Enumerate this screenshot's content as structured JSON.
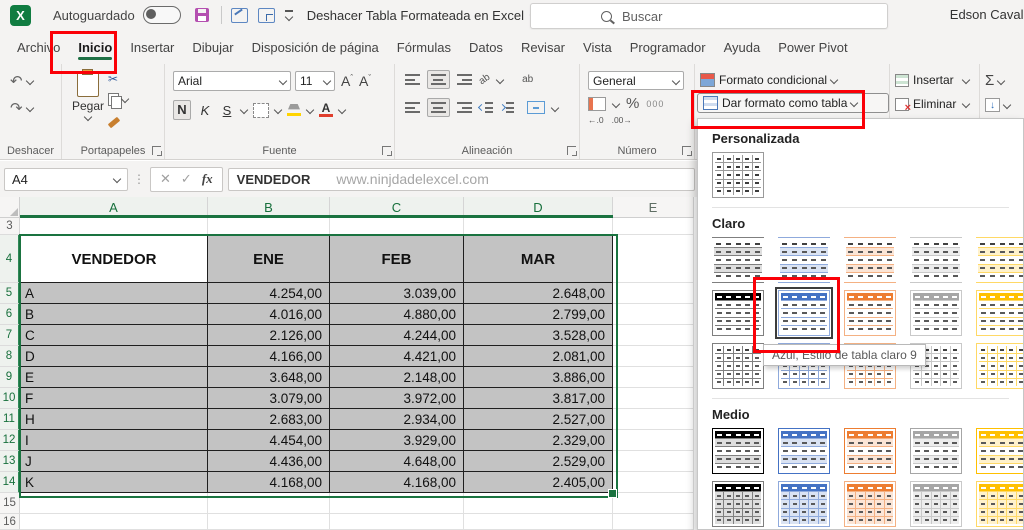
{
  "title_bar": {
    "autosave": "Autoguardado",
    "undo_action": "Deshacer Tabla Formateada en Excel",
    "search_placeholder": "Buscar",
    "user": "Edson Cavalc"
  },
  "tabs": [
    {
      "label": "Archivo",
      "active": false
    },
    {
      "label": "Inicio",
      "active": true
    },
    {
      "label": "Insertar",
      "active": false
    },
    {
      "label": "Dibujar",
      "active": false
    },
    {
      "label": "Disposición de página",
      "active": false
    },
    {
      "label": "Fórmulas",
      "active": false
    },
    {
      "label": "Datos",
      "active": false
    },
    {
      "label": "Revisar",
      "active": false
    },
    {
      "label": "Vista",
      "active": false
    },
    {
      "label": "Programador",
      "active": false
    },
    {
      "label": "Ayuda",
      "active": false
    },
    {
      "label": "Power Pivot",
      "active": false
    }
  ],
  "ribbon": {
    "group_labels": [
      "Deshacer",
      "Portapapeles",
      "Fuente",
      "Alineación",
      "Número"
    ],
    "pegar": "Pegar",
    "font_name": "Arial",
    "font_size": "11",
    "bold": "N",
    "italic": "K",
    "underline": "S",
    "orient": "ab",
    "wrap": "ab",
    "number_format": "General",
    "percent": "%",
    "thousands": "000",
    "dec_left": "←.0",
    "dec_right": ".00→",
    "conditional": "Formato condicional",
    "format_table": "Dar formato como tabla",
    "insert": "Insertar",
    "delete": "Eliminar"
  },
  "icons": {
    "undo": "↶",
    "redo": "↷",
    "cut": "✂",
    "sum": "Σ",
    "down": "↓",
    "check": "✓",
    "cancel": "✕"
  },
  "formula_bar": {
    "name_box": "A4",
    "fx": "fx",
    "content": "VENDEDOR",
    "watermark": "www.ninjdadelexcel.com"
  },
  "sheet": {
    "col_headers": [
      "A",
      "B",
      "C",
      "D",
      "E"
    ],
    "selected_cols": 4,
    "rows": [
      {
        "n": "3"
      },
      {
        "n": "4",
        "in_table": true,
        "header": true,
        "cells": [
          "VENDEDOR",
          "ENE",
          "FEB",
          "MAR"
        ]
      },
      {
        "n": "5",
        "in_table": true,
        "cells": [
          "A",
          "4.254,00",
          "3.039,00",
          "2.648,00"
        ]
      },
      {
        "n": "6",
        "in_table": true,
        "cells": [
          "B",
          "4.016,00",
          "4.880,00",
          "2.799,00"
        ]
      },
      {
        "n": "7",
        "in_table": true,
        "cells": [
          "C",
          "2.126,00",
          "4.244,00",
          "3.528,00"
        ]
      },
      {
        "n": "8",
        "in_table": true,
        "cells": [
          "D",
          "4.166,00",
          "4.421,00",
          "2.081,00"
        ]
      },
      {
        "n": "9",
        "in_table": true,
        "cells": [
          "E",
          "3.648,00",
          "2.148,00",
          "3.886,00"
        ]
      },
      {
        "n": "10",
        "in_table": true,
        "cells": [
          "F",
          "3.079,00",
          "3.972,00",
          "3.817,00"
        ]
      },
      {
        "n": "11",
        "in_table": true,
        "cells": [
          "H",
          "2.683,00",
          "2.934,00",
          "2.527,00"
        ]
      },
      {
        "n": "12",
        "in_table": true,
        "cells": [
          "I",
          "4.454,00",
          "3.929,00",
          "2.329,00"
        ]
      },
      {
        "n": "13",
        "in_table": true,
        "cells": [
          "J",
          "4.436,00",
          "4.648,00",
          "2.529,00"
        ]
      },
      {
        "n": "14",
        "in_table": true,
        "cells": [
          "K",
          "4.168,00",
          "4.168,00",
          "2.405,00"
        ]
      },
      {
        "n": "15"
      },
      {
        "n": "16"
      }
    ]
  },
  "gallery": {
    "sections": [
      {
        "title": "Personalizada",
        "rows": [
          [
            {
              "v": "custom",
              "t": "gray"
            }
          ]
        ]
      },
      {
        "title": "Claro",
        "rows": [
          [
            {
              "v": "lines",
              "t": "dark"
            },
            {
              "v": "lines",
              "t": "blue"
            },
            {
              "v": "lines",
              "t": "orange"
            },
            {
              "v": "lines",
              "t": "gray"
            },
            {
              "v": "lines",
              "t": "yellow"
            }
          ],
          [
            {
              "v": "header",
              "t": "dark"
            },
            {
              "v": "header",
              "t": "blue"
            },
            {
              "v": "header",
              "t": "orange"
            },
            {
              "v": "header",
              "t": "gray"
            },
            {
              "v": "header",
              "t": "yellow"
            }
          ],
          [
            {
              "v": "grid",
              "t": "dark"
            },
            {
              "v": "grid",
              "t": "blue"
            },
            {
              "v": "grid",
              "t": "orange"
            },
            {
              "v": "grid",
              "t": "gray"
            },
            {
              "v": "grid",
              "t": "yellow"
            }
          ]
        ]
      },
      {
        "title": "Medio",
        "rows": [
          [
            {
              "v": "medium",
              "t": "dark"
            },
            {
              "v": "medium",
              "t": "blue"
            },
            {
              "v": "medium",
              "t": "orange"
            },
            {
              "v": "medium",
              "t": "gray"
            },
            {
              "v": "medium",
              "t": "yellow"
            }
          ],
          [
            {
              "v": "cells",
              "t": "dark"
            },
            {
              "v": "cells",
              "t": "blue"
            },
            {
              "v": "cells",
              "t": "orange"
            },
            {
              "v": "cells",
              "t": "gray"
            },
            {
              "v": "cells",
              "t": "yellow"
            }
          ]
        ]
      }
    ],
    "selected": {
      "section": 1,
      "row": 1,
      "col": 1
    },
    "selected_style_name": "Azul, Estilo de tabla claro 9",
    "tooltip": "Azul, Estilo de tabla claro 9"
  },
  "colors": {
    "excel_green": "#107c41",
    "selection_green": "#1a7340",
    "annotation_red": "#fb0007",
    "cell_fill": "#c3c3c3",
    "themes": {
      "dark": {
        "main": "#000000",
        "mid": "#7f7f7f",
        "light": "#dedede"
      },
      "blue": {
        "main": "#4472c4",
        "mid": "#8faadc",
        "light": "#dae3f3"
      },
      "orange": {
        "main": "#ed7d31",
        "mid": "#f4b183",
        "light": "#fbe5d6"
      },
      "gray": {
        "main": "#a6a6a6",
        "mid": "#c9c9c9",
        "light": "#ededed"
      },
      "yellow": {
        "main": "#ffc000",
        "mid": "#ffd966",
        "light": "#fff2cc"
      }
    }
  }
}
